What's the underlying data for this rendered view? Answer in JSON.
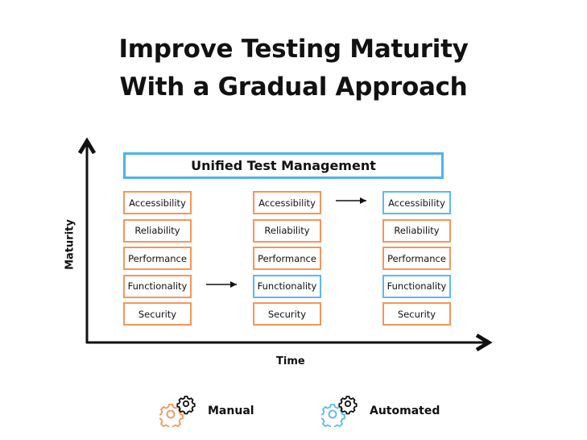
{
  "title": {
    "line1": "Improve Testing Maturity",
    "line2": "With a Gradual Approach"
  },
  "banner": {
    "label": "Unified Test Management"
  },
  "axes": {
    "y_label": "Maturity",
    "x_label": "Time"
  },
  "colors": {
    "manual": "#f5955a",
    "automated": "#5ab9f0",
    "banner_border": "#4db3ee",
    "axis": "#111111"
  },
  "stages": [
    {
      "boxes": [
        {
          "label": "Accessibility",
          "mode": "manual"
        },
        {
          "label": "Reliability",
          "mode": "manual"
        },
        {
          "label": "Performance",
          "mode": "manual"
        },
        {
          "label": "Functionality",
          "mode": "manual"
        },
        {
          "label": "Security",
          "mode": "manual"
        }
      ]
    },
    {
      "boxes": [
        {
          "label": "Accessibility",
          "mode": "manual"
        },
        {
          "label": "Reliability",
          "mode": "manual"
        },
        {
          "label": "Performance",
          "mode": "manual"
        },
        {
          "label": "Functionality",
          "mode": "automated"
        },
        {
          "label": "Security",
          "mode": "manual"
        }
      ]
    },
    {
      "boxes": [
        {
          "label": "Accessibility",
          "mode": "automated"
        },
        {
          "label": "Reliability",
          "mode": "manual"
        },
        {
          "label": "Performance",
          "mode": "manual"
        },
        {
          "label": "Functionality",
          "mode": "automated"
        },
        {
          "label": "Security",
          "mode": "manual"
        }
      ]
    }
  ],
  "transitions": [
    {
      "from_stage": 1,
      "to_stage": 2,
      "row": "Functionality"
    },
    {
      "from_stage": 2,
      "to_stage": 3,
      "row": "Accessibility"
    }
  ],
  "legend": [
    {
      "label": "Manual",
      "icon": "gears-orange-icon"
    },
    {
      "label": "Automated",
      "icon": "gears-blue-icon"
    }
  ]
}
